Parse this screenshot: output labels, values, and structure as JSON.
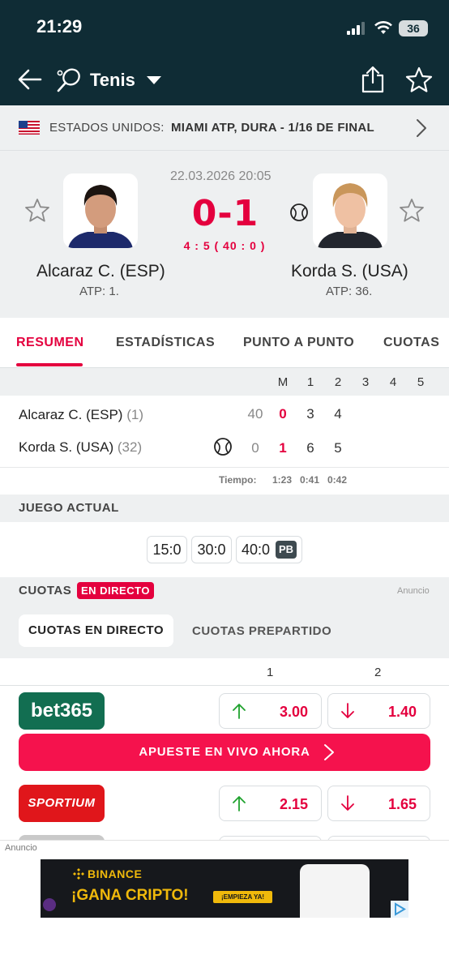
{
  "status_bar": {
    "time": "21:29",
    "battery": "36"
  },
  "header": {
    "sport": "Tenis",
    "icons": [
      "back-arrow-icon",
      "tennis-racket-icon",
      "chevron-down-icon",
      "share-icon",
      "star-icon"
    ]
  },
  "breadcrumb": {
    "country": "ESTADOS UNIDOS:",
    "tournament": "MIAMI ATP, DURA - 1/16 DE FINAL"
  },
  "match": {
    "datetime": "22.03.2026 20:05",
    "score": "0-1",
    "game_score": "4 : 5 ( 40 : 0 )",
    "home": {
      "name": "Alcaraz C. (ESP)",
      "rank": "ATP: 1."
    },
    "away": {
      "name": "Korda S. (USA)",
      "rank": "ATP: 36."
    }
  },
  "tabs": [
    "RESUMEN",
    "ESTADÍSTICAS",
    "PUNTO A PUNTO",
    "CUOTAS"
  ],
  "scoreboard": {
    "columns": [
      "M",
      "1",
      "2",
      "3",
      "4",
      "5"
    ],
    "rows": [
      {
        "name": "Alcaraz C. (ESP)",
        "rank": "(1)",
        "points": "40",
        "sets": "0",
        "set1": "3",
        "set2": "4"
      },
      {
        "name": "Korda S. (USA)",
        "rank": "(32)",
        "points": "0",
        "sets": "1",
        "set1": "6",
        "set2": "5"
      }
    ],
    "time_label": "Tiempo:",
    "times": [
      "1:23",
      "0:41",
      "0:42"
    ]
  },
  "current_game": {
    "title": "JUEGO ACTUAL",
    "points": [
      "15:0",
      "30:0",
      "40:0"
    ],
    "badge": "PB"
  },
  "odds": {
    "title": "CUOTAS",
    "live_badge": "EN DIRECTO",
    "ad_label": "Anuncio",
    "tabs": [
      "CUOTAS EN DIRECTO",
      "CUOTAS PREPARTIDO"
    ],
    "col_headers": [
      "1",
      "2"
    ],
    "bookmakers": [
      {
        "name": "bet365",
        "odd1": "3.00",
        "odd2": "1.40",
        "trend1": "up",
        "trend2": "down"
      },
      {
        "name": "SPORTIUM",
        "odd1": "2.15",
        "odd2": "1.65",
        "trend1": "up",
        "trend2": "down"
      }
    ],
    "cta": "APUESTE EN VIVO AHORA"
  },
  "ad": {
    "label": "Anuncio",
    "brand": "BINANCE",
    "headline": "¡GANA CRIPTO!",
    "cta": "¡EMPIEZA YA!"
  },
  "colors": {
    "header_bg": "#0f2c35",
    "accent": "#e4003e",
    "section_bg": "#eef0f1",
    "up": "#1fa22e",
    "bet365": "#126e51",
    "sportium": "#e0161b",
    "binance": "#f0b90b"
  }
}
